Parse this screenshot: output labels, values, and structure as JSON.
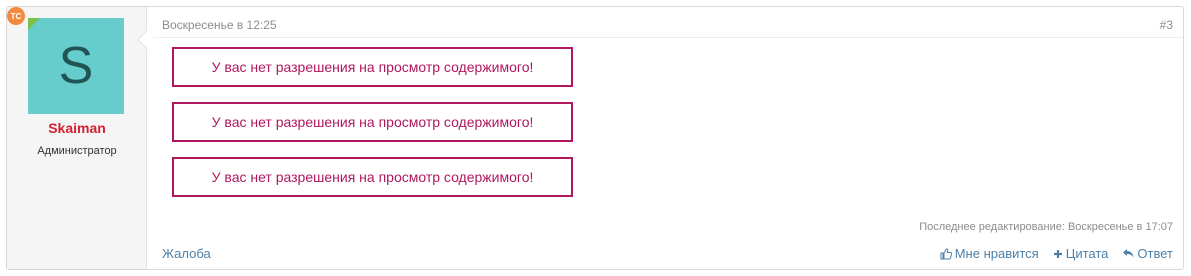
{
  "user": {
    "avatar_letter": "S",
    "badge": "TC",
    "username": "Skaiman",
    "title": "Администратор",
    "avatar_color": "#66cccc",
    "username_color": "#d3202f"
  },
  "post": {
    "date": "Воскресенье в 12:25",
    "number": "#3",
    "notices": [
      "У вас нет разрешения на просмотр содержимого!",
      "У вас нет разрешения на просмотр содержимого!",
      "У вас нет разрешения на просмотр содержимого!"
    ],
    "last_edited": "Последнее редактирование: Воскресенье в 17:07",
    "notice_color": "#b0175f"
  },
  "footer": {
    "report": "Жалоба",
    "like": "Мне нравится",
    "quote": "Цитата",
    "reply": "Ответ",
    "link_color": "#4e7fa7"
  },
  "icons": {
    "like": "thumbs-up-icon",
    "quote": "plus-icon",
    "reply": "reply-arrow-icon"
  }
}
